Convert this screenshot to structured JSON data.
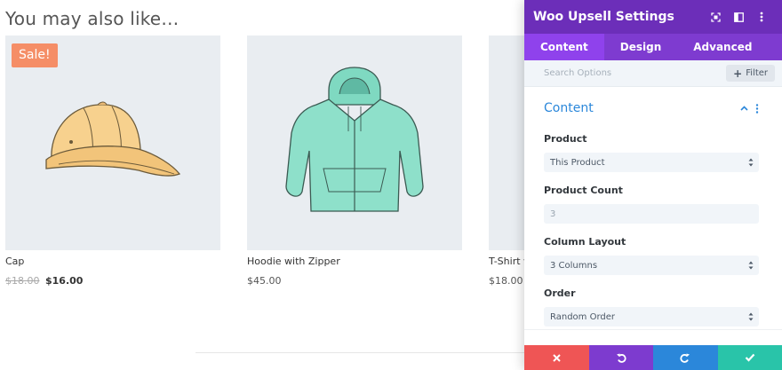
{
  "storefront": {
    "section_title": "You may also like…",
    "products": [
      {
        "name": "Cap",
        "badge": "Sale!",
        "price_old": "$18.00",
        "price": "$16.00"
      },
      {
        "name": "Hoodie with Zipper",
        "price": "$45.00"
      },
      {
        "name": "T-Shirt w",
        "price": "$18.00"
      }
    ]
  },
  "modal": {
    "title": "Woo Upsell Settings",
    "header_icons": [
      "expand-icon",
      "split-view-icon",
      "more-icon"
    ],
    "tabs": [
      {
        "label": "Content",
        "active": true
      },
      {
        "label": "Design",
        "active": false
      },
      {
        "label": "Advanced",
        "active": false
      }
    ],
    "search": {
      "placeholder": "Search Options",
      "filter_label": "Filter"
    },
    "panel": {
      "title": "Content",
      "fields": [
        {
          "label": "Product",
          "value": "This Product",
          "kind": "select"
        },
        {
          "label": "Product Count",
          "value": "3",
          "kind": "number"
        },
        {
          "label": "Column Layout",
          "value": "3 Columns",
          "kind": "select"
        },
        {
          "label": "Order",
          "value": "Random Order",
          "kind": "select"
        }
      ]
    },
    "footer": [
      "close-icon",
      "undo-icon",
      "redo-icon",
      "check-icon"
    ]
  },
  "colors": {
    "header": "#6c2eb9",
    "tabs": "#7e3bd0",
    "tab_active": "#8f42ec",
    "accent_blue": "#2b87da",
    "cancel": "#ef5555",
    "save": "#29c4a9",
    "sale_badge": "#f58e67"
  }
}
